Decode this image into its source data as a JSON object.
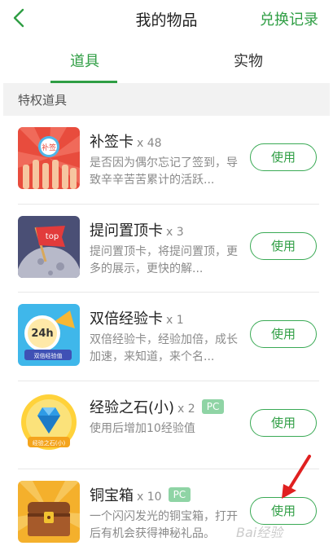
{
  "header": {
    "title": "我的物品",
    "exchange_label": "兑换记录"
  },
  "tabs": [
    {
      "label": "道具"
    },
    {
      "label": "实物"
    }
  ],
  "section": {
    "title": "特权道具"
  },
  "items": [
    {
      "name": "补签卡",
      "qty": "x 48",
      "desc": "是否因为偶尔忘记了签到，导致辛辛苦苦累计的活跃...",
      "badge": "",
      "button": "使用",
      "thumb_text": "补签"
    },
    {
      "name": "提问置顶卡",
      "qty": "x 3",
      "desc": "提问置顶卡，将提问置顶，更多的展示，更快的解...",
      "badge": "",
      "button": "使用",
      "thumb_text": "top"
    },
    {
      "name": "双倍经验卡",
      "qty": "x 1",
      "desc": "双倍经验卡，经验加倍，成长加速，来知道，来个名...",
      "badge": "",
      "button": "使用",
      "thumb_text": "24h",
      "thumb_sub": "双倍经验值"
    },
    {
      "name": "经验之石(小)",
      "qty": "x 2",
      "desc": "使用后增加10经验值",
      "badge": "PC",
      "button": "使用",
      "thumb_text": "经验之石(小)"
    },
    {
      "name": "铜宝箱",
      "qty": "x 10",
      "desc": "一个闪闪发光的铜宝箱，打开后有机会获得神秘礼品。",
      "badge": "PC",
      "button": "使用"
    }
  ],
  "watermark": "Bai经验",
  "colors": {
    "accent": "#2f9e44",
    "badge": "#8fd4a5",
    "section_bg": "#f2f2f2",
    "arrow": "#e02020"
  },
  "icons": [
    "back-arrow-icon",
    "red-pointer-arrow-icon"
  ]
}
